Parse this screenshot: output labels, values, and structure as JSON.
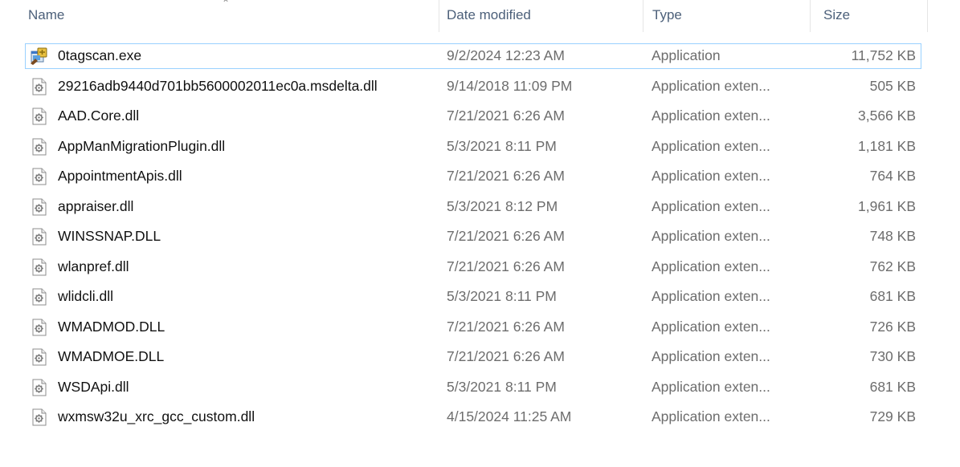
{
  "columns": {
    "name": "Name",
    "date": "Date modified",
    "type": "Type",
    "size": "Size"
  },
  "files": [
    {
      "name": "0tagscan.exe",
      "date": "9/2/2024 12:23 AM",
      "type": "Application",
      "size": "11,752 KB",
      "icon": "application-exe-icon"
    },
    {
      "name": "29216adb9440d701bb5600002011ec0a.msdelta.dll",
      "date": "9/14/2018 11:09 PM",
      "type": "Application exten...",
      "size": "505 KB",
      "icon": "dll-file-icon"
    },
    {
      "name": "AAD.Core.dll",
      "date": "7/21/2021 6:26 AM",
      "type": "Application exten...",
      "size": "3,566 KB",
      "icon": "dll-file-icon"
    },
    {
      "name": "AppManMigrationPlugin.dll",
      "date": "5/3/2021 8:11 PM",
      "type": "Application exten...",
      "size": "1,181 KB",
      "icon": "dll-file-icon"
    },
    {
      "name": "AppointmentApis.dll",
      "date": "7/21/2021 6:26 AM",
      "type": "Application exten...",
      "size": "764 KB",
      "icon": "dll-file-icon"
    },
    {
      "name": "appraiser.dll",
      "date": "5/3/2021 8:12 PM",
      "type": "Application exten...",
      "size": "1,961 KB",
      "icon": "dll-file-icon"
    },
    {
      "name": "WINSSNAP.DLL",
      "date": "7/21/2021 6:26 AM",
      "type": "Application exten...",
      "size": "748 KB",
      "icon": "dll-file-icon"
    },
    {
      "name": "wlanpref.dll",
      "date": "7/21/2021 6:26 AM",
      "type": "Application exten...",
      "size": "762 KB",
      "icon": "dll-file-icon"
    },
    {
      "name": "wlidcli.dll",
      "date": "5/3/2021 8:11 PM",
      "type": "Application exten...",
      "size": "681 KB",
      "icon": "dll-file-icon"
    },
    {
      "name": "WMADMOD.DLL",
      "date": "7/21/2021 6:26 AM",
      "type": "Application exten...",
      "size": "726 KB",
      "icon": "dll-file-icon"
    },
    {
      "name": "WMADMOE.DLL",
      "date": "7/21/2021 6:26 AM",
      "type": "Application exten...",
      "size": "730 KB",
      "icon": "dll-file-icon"
    },
    {
      "name": "WSDApi.dll",
      "date": "5/3/2021 8:11 PM",
      "type": "Application exten...",
      "size": "681 KB",
      "icon": "dll-file-icon"
    },
    {
      "name": "wxmsw32u_xrc_gcc_custom.dll",
      "date": "4/15/2024 11:25 AM",
      "type": "Application exten...",
      "size": "729 KB",
      "icon": "dll-file-icon"
    }
  ],
  "focused_index": 0,
  "colors": {
    "header_text": "#4c607a",
    "secondary_text": "#6d6d6d",
    "focus_border": "#99d1ff"
  }
}
